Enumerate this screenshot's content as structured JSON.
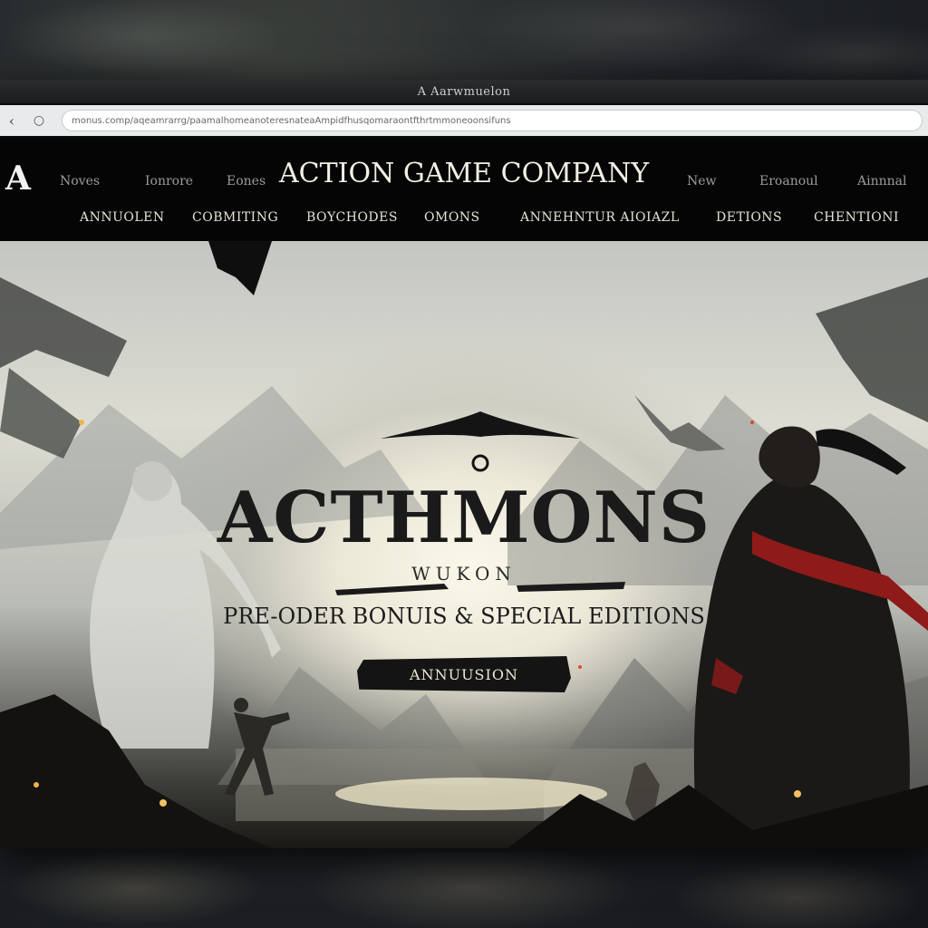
{
  "window": {
    "title": "A Aarwmuelon"
  },
  "addressbar": {
    "back_icon": "chevron-left-icon",
    "reload_icon": "reload-icon",
    "url_prefix": "monus",
    "url": "monus.comp/aqeamrarrg/paamalhomeanoteresnateaAmpidfhusqomaraontfthrtmmoneoonsifuns"
  },
  "header": {
    "logo": "A",
    "brand": "ACTION GAME COMPANY",
    "top_links": [
      "Noves",
      "Ionrore",
      "Eones",
      "New",
      "Eroanoul",
      "Ainnnal"
    ],
    "sub_nav": [
      "ANNUOLEN",
      "COBMITING",
      "BOYCHODES",
      "OMONS",
      "ANNEHNTUR AIOIAZL",
      "DETIONS",
      "CHENTIONI"
    ]
  },
  "hero": {
    "title": "ACTHMONS",
    "subtitle": "WUKON",
    "tagline": "PRE-ODER BONUIS & SPECIAL EDITIONS",
    "cta_label": "ANNUUSION"
  },
  "colors": {
    "header_bg": "#050505",
    "hero_glow": "#fbf8ea",
    "scarf_red": "#8e1a1a",
    "button_bg": "#141414"
  }
}
